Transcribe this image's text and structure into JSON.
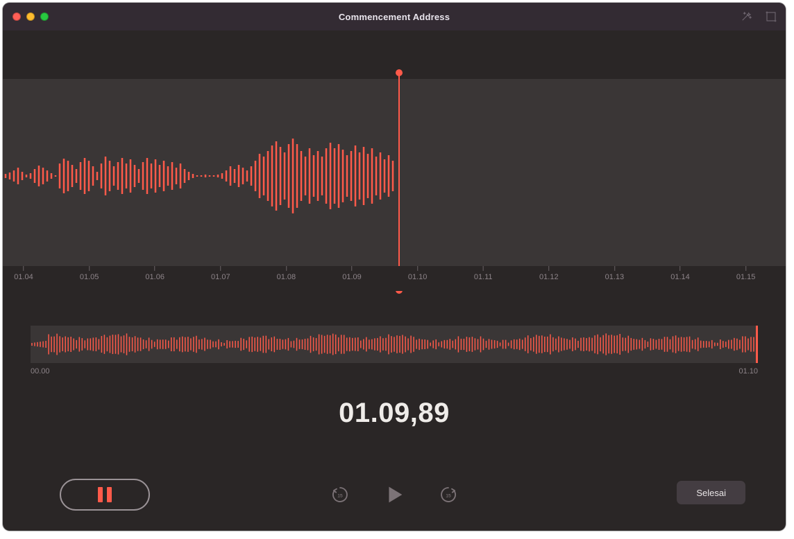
{
  "window": {
    "title": "Commencement Address"
  },
  "ruler": {
    "ticks": [
      "01.04",
      "01.05",
      "01.06",
      "01.07",
      "01.08",
      "01.09",
      "01.10",
      "01.11",
      "01.12",
      "01.13",
      "01.14",
      "01.15"
    ]
  },
  "overview": {
    "start": "00.00",
    "end": "01.10"
  },
  "timer": "01.09,89",
  "controls": {
    "skip_seconds": "15",
    "done_label": "Selesai"
  },
  "colors": {
    "accent": "#ff5a4a"
  }
}
